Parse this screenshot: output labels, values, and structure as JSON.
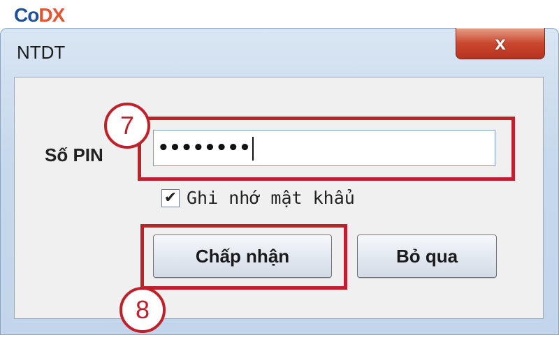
{
  "logo": {
    "text_a": "Co",
    "text_b": "DX"
  },
  "window": {
    "title": "NTDT",
    "close_label": "x"
  },
  "form": {
    "pin_label": "Số PIN",
    "pin_value": "••••••••",
    "remember_checked": true,
    "remember_mark": "✔",
    "remember_label": "Ghi nhớ mật khẩu",
    "accept_label": "Chấp nhận",
    "cancel_label": "Bỏ qua"
  },
  "annotations": {
    "step_pin": "7",
    "step_accept": "8",
    "highlight_color": "#c0202a"
  }
}
